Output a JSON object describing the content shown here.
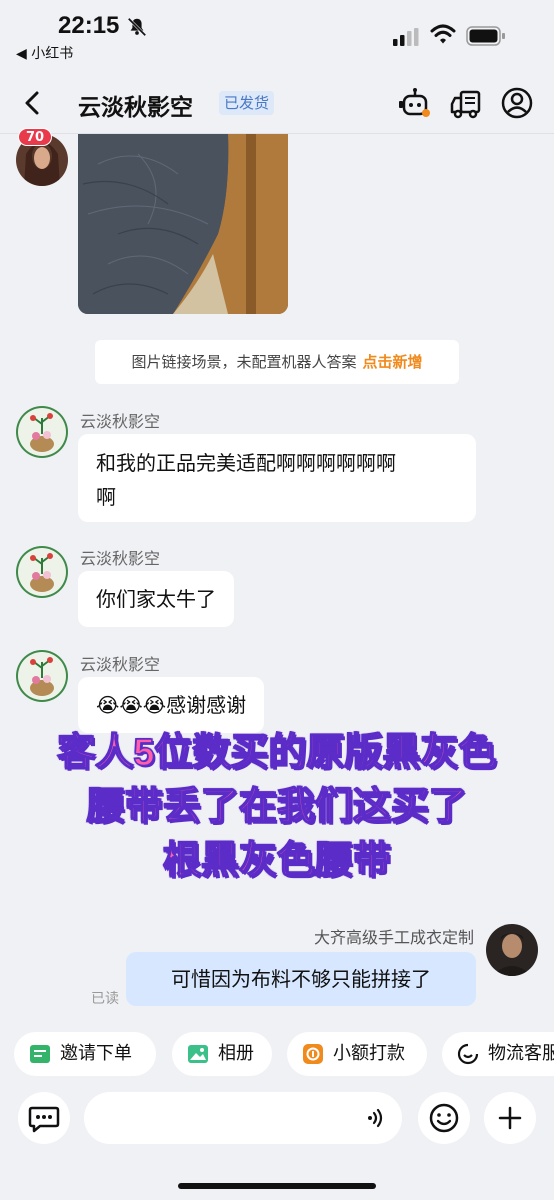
{
  "status_bar": {
    "time": "22:15",
    "back_app": "◀ 小红书"
  },
  "header": {
    "title": "云淡秋影空",
    "badge": "已发货",
    "icons": [
      "robot-icon",
      "truck-icon",
      "user-icon"
    ]
  },
  "chat": {
    "unread_badge": "70",
    "system_tip": {
      "text": "图片链接场景，未配置机器人答案",
      "link": "点击新增"
    },
    "messages": [
      {
        "sender": "云淡秋影空",
        "text_line1": "和我的正品完美适配啊啊啊啊啊啊",
        "text_line2": "啊"
      },
      {
        "sender": "云淡秋影空",
        "text": "你们家太牛了"
      },
      {
        "sender": "云淡秋影空",
        "emoji": "😭😭😭",
        "text": "感谢感谢"
      }
    ],
    "outgoing": {
      "sender": "大齐高级手工成衣定制",
      "text": "可惜因为布料不够只能拼接了",
      "read_status": "已读"
    }
  },
  "overlay_caption": {
    "line1": "客人5位数买的原版黑灰色",
    "line2": "腰带丢了在我们这买了",
    "line3": "根黑灰色腰带"
  },
  "quick_actions": [
    {
      "label": "邀请下单",
      "icon": "invite-order-icon",
      "color": "#34b36b"
    },
    {
      "label": "相册",
      "icon": "album-icon",
      "color": "#3cc08a"
    },
    {
      "label": "小额打款",
      "icon": "payment-icon",
      "color": "#f08a1d"
    },
    {
      "label": "物流客服",
      "icon": "logistics-service-icon",
      "color": "#111111"
    }
  ],
  "input_bar": {
    "icons": [
      "chat-menu-icon",
      "voice-icon",
      "emoji-icon",
      "plus-icon"
    ]
  }
}
